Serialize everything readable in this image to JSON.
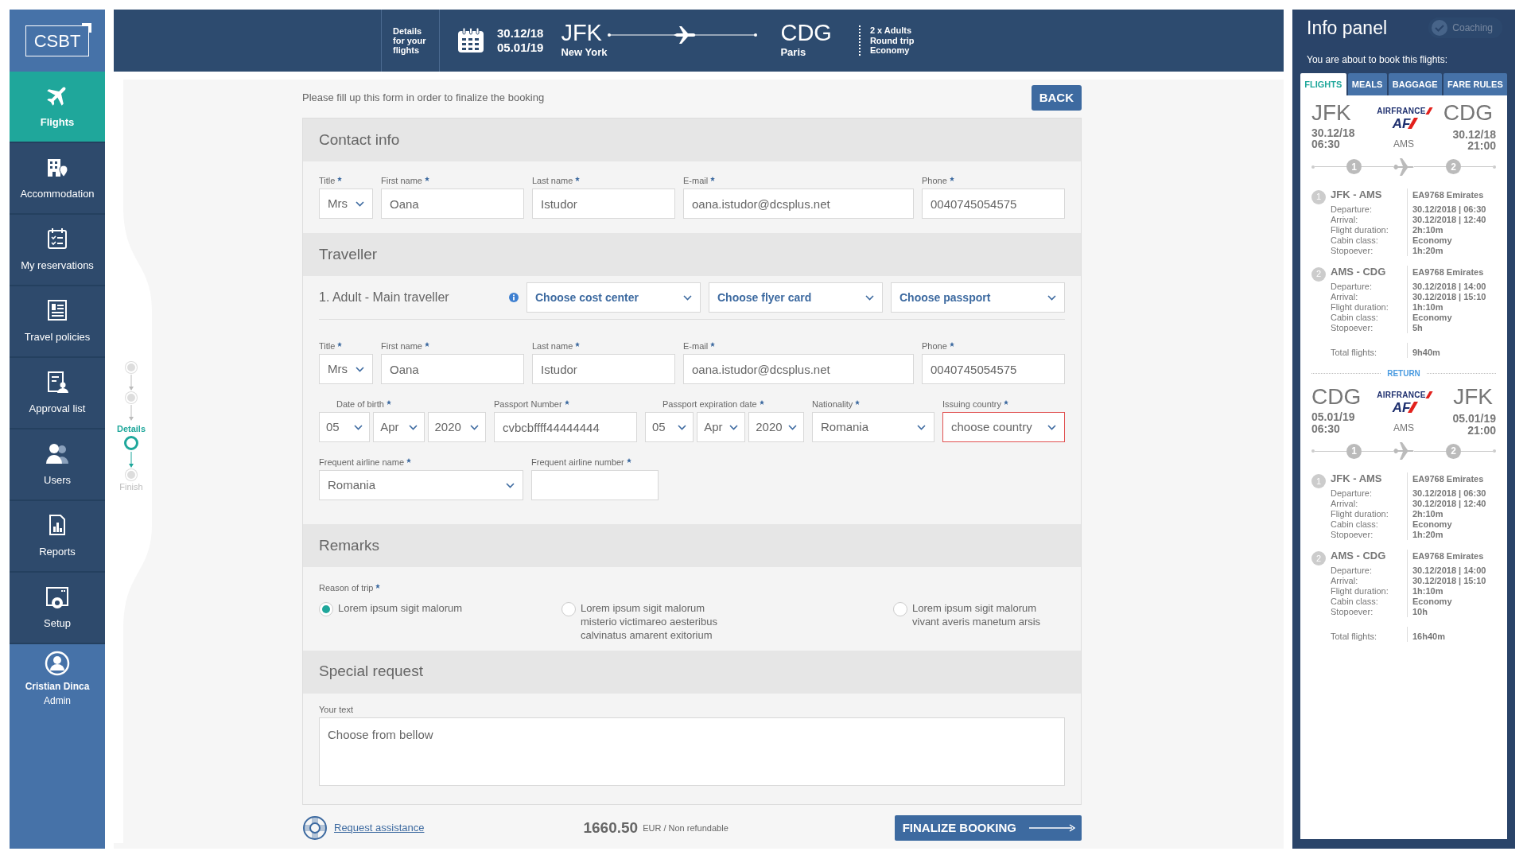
{
  "sidebar": {
    "logo": "CSBT",
    "items": [
      {
        "label": "Flights",
        "selected": true
      },
      {
        "label": "Accommodation",
        "selected": false
      },
      {
        "label": "My reservations",
        "selected": false
      },
      {
        "label": "Travel policies",
        "selected": false
      },
      {
        "label": "Approval list",
        "selected": false
      },
      {
        "label": "Users",
        "selected": false
      },
      {
        "label": "Reports",
        "selected": false
      },
      {
        "label": "Setup",
        "selected": false
      }
    ],
    "user": {
      "name": "Cristian Dinca",
      "role": "Admin"
    }
  },
  "header": {
    "details_label": "Details for your flights",
    "dates": [
      "30.12/18",
      "05.01/19"
    ],
    "origin": {
      "code": "JFK",
      "city": "New York"
    },
    "destination": {
      "code": "CDG",
      "city": "Paris"
    },
    "trip": [
      "2 x Adults",
      "Round trip",
      "Economy"
    ]
  },
  "stepper": [
    {
      "selected": false
    },
    {
      "selected": false
    },
    {
      "label": "Details",
      "selected": true
    },
    {
      "label": "Finish",
      "selected": false
    }
  ],
  "form": {
    "instruction": "Please fill up this form in order to finalize the booking",
    "back_button": "BACK",
    "contact": {
      "title": "Contact info",
      "fields": [
        {
          "kind": "select",
          "label": "Title",
          "required": true,
          "value": "Mrs"
        },
        {
          "kind": "input",
          "label": "First name",
          "required": true,
          "value": "Oana"
        },
        {
          "kind": "input",
          "label": "Last name",
          "required": true,
          "value": "Istudor"
        },
        {
          "kind": "input",
          "label": "E-mail",
          "required": true,
          "value": "oana.istudor@dcsplus.net"
        },
        {
          "kind": "input",
          "label": "Phone",
          "required": true,
          "value": "0040745054575"
        }
      ]
    },
    "traveller": {
      "title": "Traveller",
      "name": "1. Adult - Main traveller",
      "selectors": [
        "Choose cost center",
        "Choose flyer card",
        "Choose passport"
      ],
      "personal": [
        {
          "kind": "select",
          "label": "Title",
          "required": true,
          "value": "Mrs"
        },
        {
          "kind": "input",
          "label": "First name",
          "required": true,
          "value": "Oana"
        },
        {
          "kind": "input",
          "label": "Last name",
          "required": true,
          "value": "Istudor"
        },
        {
          "kind": "input",
          "label": "E-mail",
          "required": true,
          "value": "oana.istudor@dcsplus.net"
        },
        {
          "kind": "input",
          "label": "Phone",
          "required": true,
          "value": "0040745054575"
        }
      ],
      "documents": [
        {
          "kind": "date",
          "label": "Date of birth",
          "required": true,
          "values": [
            "05",
            "Apr",
            "2020"
          ],
          "invalid": false
        },
        {
          "kind": "input",
          "label": "Passport Number",
          "required": true,
          "value": "cvbcbffff44444444",
          "invalid": false
        },
        {
          "kind": "date",
          "label": "Passport expiration date",
          "required": true,
          "values": [
            "05",
            "Apr",
            "2020"
          ],
          "invalid": false
        },
        {
          "kind": "select",
          "label": "Nationality",
          "required": true,
          "value": "Romania",
          "invalid": false
        },
        {
          "kind": "select",
          "label": "Issuing country",
          "required": true,
          "value": "choose country",
          "invalid": true
        }
      ],
      "frequent_flyer": [
        {
          "kind": "select",
          "label": "Frequent airline name",
          "required": true,
          "value": "Romania"
        },
        {
          "kind": "input",
          "label": "Frequent airline number",
          "required": true
        }
      ]
    },
    "remarks": {
      "title": "Remarks",
      "label": "Reason of trip",
      "required": true,
      "options": [
        {
          "text": "Lorem ipsum sigit malorum",
          "selected": true
        },
        {
          "text": "Lorem ipsum sigit malorum misterio victimareo aesteribus calvinatus amarent exitorium",
          "selected": false
        },
        {
          "text": "Lorem ipsum sigit malorum vivant averis manetum arsis",
          "selected": false
        }
      ]
    },
    "special": {
      "title": "Special request",
      "label": "Your text",
      "placeholder": "Choose from bellow"
    }
  },
  "footer": {
    "assistance": "Request assistance",
    "price": "1660.50",
    "price_note": "EUR / Non refundable",
    "finalize_button": "FINALIZE BOOKING"
  },
  "info_panel": {
    "title": "Info panel",
    "coaching": {
      "label": "Coaching",
      "disabled": true
    },
    "subtitle": "You are about to book this flights:",
    "tabs": [
      {
        "label": "FLIGHTS",
        "selected": true
      },
      {
        "label": "MEALS",
        "selected": false
      },
      {
        "label": "BAGGAGE",
        "selected": false
      },
      {
        "label": "FARE RULES",
        "selected": false
      }
    ],
    "journeys": [
      {
        "from": {
          "code": "JFK",
          "date": "30.12/18",
          "time": "06:30"
        },
        "to": {
          "code": "CDG",
          "date": "30.12/18",
          "time": "21:00"
        },
        "airline": {
          "name": "AIRFRANCE",
          "code": "AF"
        },
        "via": "AMS",
        "stops": [
          "1",
          "2"
        ],
        "legs": [
          {
            "number": "1",
            "route": "JFK - AMS",
            "flight": "EA9768 Emirates",
            "details": [
              {
                "label": "Departure:",
                "value": "30.12/2018 | 06:30"
              },
              {
                "label": "Arrival:",
                "value": "30.12/2018 | 12:40"
              },
              {
                "label": "Flight duration:",
                "value": "2h:10m"
              },
              {
                "label": "Cabin class:",
                "value": "Economy"
              },
              {
                "label": "Stopoever:",
                "value": "1h:20m"
              }
            ]
          },
          {
            "number": "2",
            "route": "AMS - CDG",
            "flight": "EA9768 Emirates",
            "details": [
              {
                "label": "Departure:",
                "value": "30.12/2018 | 14:00"
              },
              {
                "label": "Arrival:",
                "value": "30.12/2018 | 15:10"
              },
              {
                "label": "Flight duration:",
                "value": "1h:10m"
              },
              {
                "label": "Cabin class:",
                "value": "Economy"
              },
              {
                "label": "Stopoever:",
                "value": "5h"
              }
            ]
          }
        ],
        "total": {
          "label": "Total flights:",
          "value": "9h40m"
        }
      },
      {
        "separator": "RETURN",
        "from": {
          "code": "CDG",
          "date": "05.01/19",
          "time": "06:30"
        },
        "to": {
          "code": "JFK",
          "date": "05.01/19",
          "time": "21:00"
        },
        "airline": {
          "name": "AIRFRANCE",
          "code": "AF"
        },
        "via": "AMS",
        "stops": [
          "1",
          "2"
        ],
        "legs": [
          {
            "number": "1",
            "route": "JFK - AMS",
            "flight": "EA9768 Emirates",
            "details": [
              {
                "label": "Departure:",
                "value": "30.12/2018 | 06:30"
              },
              {
                "label": "Arrival:",
                "value": "30.12/2018 | 12:40"
              },
              {
                "label": "Flight duration:",
                "value": "2h:10m"
              },
              {
                "label": "Cabin class:",
                "value": "Economy"
              },
              {
                "label": "Stopoever:",
                "value": "1h:20m"
              }
            ]
          },
          {
            "number": "2",
            "route": "AMS - CDG",
            "flight": "EA9768 Emirates",
            "details": [
              {
                "label": "Departure:",
                "value": "30.12/2018 | 14:00"
              },
              {
                "label": "Arrival:",
                "value": "30.12/2018 | 15:10"
              },
              {
                "label": "Flight duration:",
                "value": "1h:10m"
              },
              {
                "label": "Cabin class:",
                "value": "Economy"
              },
              {
                "label": "Stopoever:",
                "value": "10h"
              }
            ]
          }
        ],
        "total": {
          "label": "Total flights:",
          "value": "16h40m"
        }
      }
    ]
  }
}
